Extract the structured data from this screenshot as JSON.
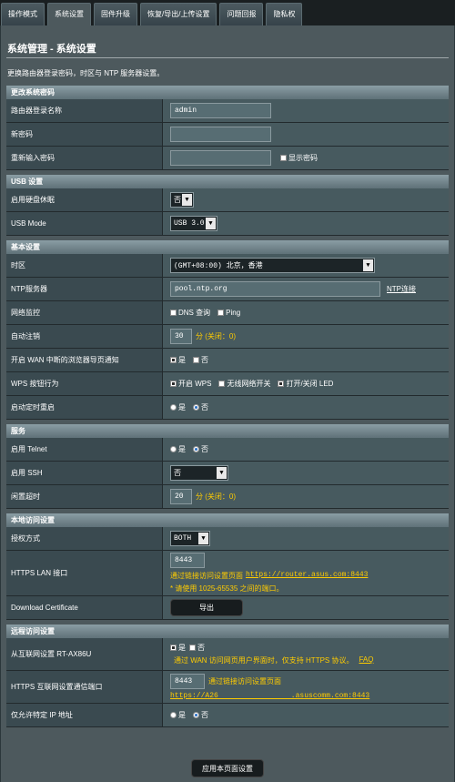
{
  "tabs": [
    "操作模式",
    "系统设置",
    "固件升级",
    "恢复/导出/上传设置",
    "问题回报",
    "隐私权"
  ],
  "page": {
    "title": "系统管理 - 系统设置",
    "description": "更换路由器登录密码，时区与 NTP 服务器设置。"
  },
  "password": {
    "section": "更改系统密码",
    "login_name_label": "路由器登录名称",
    "login_name_value": "admin",
    "new_password_label": "新密码",
    "confirm_label": "重新输入密码",
    "show_password": "显示密码"
  },
  "usb": {
    "section": "USB 设置",
    "hibernate_label": "启用硬盘休眠",
    "hibernate_value": "否",
    "mode_label": "USB Mode",
    "mode_value": "USB 3.0"
  },
  "basic": {
    "section": "基本设置",
    "timezone_label": "时区",
    "timezone_value": "(GMT+08:00) 北京，香港",
    "ntp_label": "NTP服务器",
    "ntp_value": "pool.ntp.org",
    "ntp_link": "NTP连接",
    "netmon_label": "网络监控",
    "netmon_dns": "DNS 查询",
    "netmon_ping": "Ping",
    "autologout_label": "自动注销",
    "autologout_value": "30",
    "autologout_hint": "分 (关闭：0)",
    "wan_notify_label": "开启 WAN 中断的浏览器导页通知",
    "yes": "是",
    "no": "否",
    "wps_label": "WPS 按钮行为",
    "wps_opt1": "开启 WPS",
    "wps_opt2": "无线网络开关",
    "wps_opt3": "打开/关闭 LED",
    "reboot_label": "启动定时重启"
  },
  "service": {
    "section": "服务",
    "telnet_label": "启用 Telnet",
    "ssh_label": "启用 SSH",
    "ssh_value": "否",
    "idle_label": "闲置超时",
    "idle_value": "20",
    "idle_hint": "分 (关闭：0)"
  },
  "local": {
    "section": "本地访问设置",
    "auth_label": "授权方式",
    "auth_value": "BOTH",
    "https_port_label": "HTTPS LAN 接口",
    "https_port_value": "8443",
    "https_link_prefix": "通过链接访问设置页面",
    "https_link": "https://router.asus.com:8443",
    "https_port_note": "* 请使用 1025-65535 之间的端口。",
    "cert_label": "Download Certificate",
    "cert_button": "导出"
  },
  "remote": {
    "section": "远程访问设置",
    "wan_label": "从互联网设置 RT-AX86U",
    "wan_note": "通过 WAN 访问网页用户界面时，仅支持 HTTPS 协议。",
    "wan_faq": "FAQ",
    "https_port_label": "HTTPS 互联网设置通信端口",
    "https_port_value": "8443",
    "https_link_prefix": "通过链接访问设置页面",
    "https_link": "https://A26          .asuscomm.com:8443",
    "ip_label": "仅允许特定 IP 地址"
  },
  "apply_button": "应用本页面设置"
}
